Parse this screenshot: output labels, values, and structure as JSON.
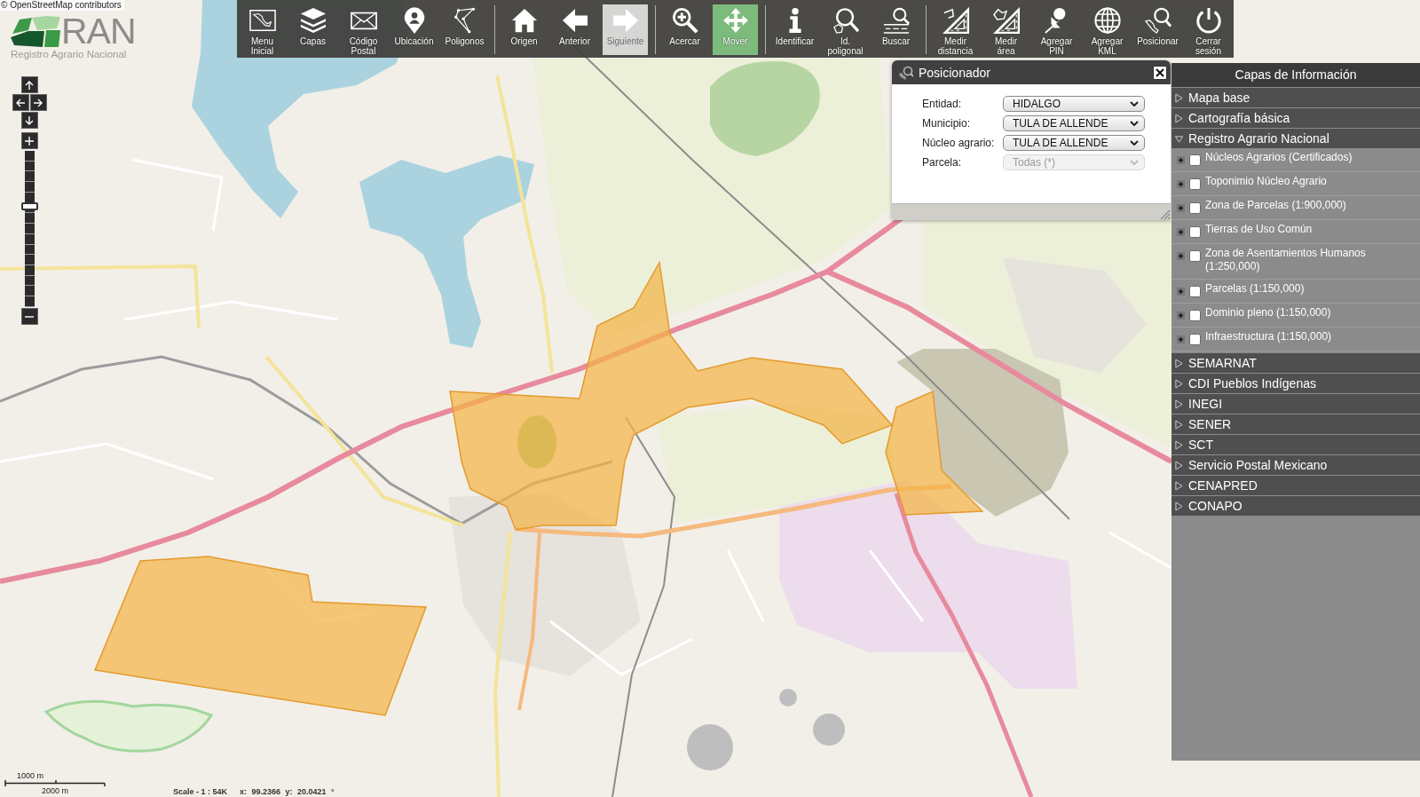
{
  "attribution": "© OpenStreetMap contributors",
  "logo": {
    "name": "RAN",
    "subtitle": "Registro Agrario Nacional"
  },
  "zoom_control": {
    "level": 0.65
  },
  "toolbar": {
    "groups": [
      {
        "tools": [
          {
            "label": "Menu\nInicial",
            "selected": false,
            "disabled": false
          },
          {
            "label": "Capas",
            "selected": false,
            "disabled": false
          },
          {
            "label": "Código\nPostal",
            "selected": false,
            "disabled": false
          },
          {
            "label": "Ubicación",
            "selected": false,
            "disabled": false
          },
          {
            "label": "Poligonos",
            "selected": false,
            "disabled": false
          }
        ]
      },
      {
        "tools": [
          {
            "label": "Origen",
            "selected": false,
            "disabled": false
          },
          {
            "label": "Anterior",
            "selected": false,
            "disabled": false
          },
          {
            "label": "Siguiente",
            "selected": false,
            "disabled": true
          }
        ]
      },
      {
        "tools": [
          {
            "label": "Acercar",
            "selected": false,
            "disabled": false
          },
          {
            "label": "Mover",
            "selected": true,
            "disabled": false
          }
        ]
      },
      {
        "tools": [
          {
            "label": "Identificar",
            "selected": false,
            "disabled": false
          },
          {
            "label": "Id.\npoligonal",
            "selected": false,
            "disabled": false
          },
          {
            "label": "Buscar",
            "selected": false,
            "disabled": false
          }
        ]
      },
      {
        "tools": [
          {
            "label": "Medir\ndistancia",
            "selected": false,
            "disabled": false
          },
          {
            "label": "Medir\nárea",
            "selected": false,
            "disabled": false
          },
          {
            "label": "Agregar\nPIN",
            "selected": false,
            "disabled": false
          },
          {
            "label": "Agregar\nKML",
            "selected": false,
            "disabled": false
          },
          {
            "label": "Posicionar",
            "selected": false,
            "disabled": false
          },
          {
            "label": "Cerrar\nsesión",
            "selected": false,
            "disabled": false
          }
        ]
      }
    ]
  },
  "positioner": {
    "title": "Posicionador",
    "fields": [
      {
        "label": "Entidad:",
        "value": "HIDALGO",
        "disabled": false
      },
      {
        "label": "Municipio:",
        "value": "TULA DE ALLENDE",
        "disabled": false
      },
      {
        "label": "Núcleo agrario:",
        "value": "TULA DE ALLENDE",
        "disabled": false
      },
      {
        "label": "Parcela:",
        "value": "Todas (*)",
        "disabled": true
      }
    ]
  },
  "layers_panel": {
    "title": "Capas de Información",
    "sections": [
      {
        "label": "Mapa base",
        "expanded": false
      },
      {
        "label": "Cartografía básica",
        "expanded": false
      },
      {
        "label": "Registro Agrario Nacional",
        "expanded": true,
        "layers": [
          {
            "label": "Núcleos Agrarios (Certificados)",
            "checked": false,
            "expanded": false
          },
          {
            "label": "Toponimio Núcleo Agrario",
            "checked": false,
            "expanded": false
          },
          {
            "label": "Zona de Parcelas (1:900,000)",
            "checked": false,
            "expanded": false
          },
          {
            "label": "Tierras de Uso Común",
            "checked": false,
            "expanded": false
          },
          {
            "label": "Zona de Asentamientos Humanos (1:250,000)",
            "checked": false,
            "expanded": false
          },
          {
            "label": "Parcelas (1:150,000)",
            "checked": false,
            "expanded": false
          },
          {
            "label": "Dominio pleno (1:150,000)",
            "checked": false,
            "expanded": false
          },
          {
            "label": "Infraestructura (1:150,000)",
            "checked": false,
            "expanded": false
          }
        ]
      },
      {
        "label": "SEMARNAT",
        "expanded": false
      },
      {
        "label": "CDI Pueblos Indígenas",
        "expanded": false
      },
      {
        "label": "INEGI",
        "expanded": false
      },
      {
        "label": "SENER",
        "expanded": false
      },
      {
        "label": "SCT",
        "expanded": false
      },
      {
        "label": "Servicio Postal Mexicano",
        "expanded": false
      },
      {
        "label": "CENAPRED",
        "expanded": false
      },
      {
        "label": "CONAPO",
        "expanded": false
      }
    ]
  },
  "scale_bar": {
    "labels": [
      "1000 m",
      "2000 m"
    ]
  },
  "status_bar": {
    "scale": "Scale - 1 : 54K",
    "coordinates": "x: 99.2366 y: 20.0421 °"
  }
}
